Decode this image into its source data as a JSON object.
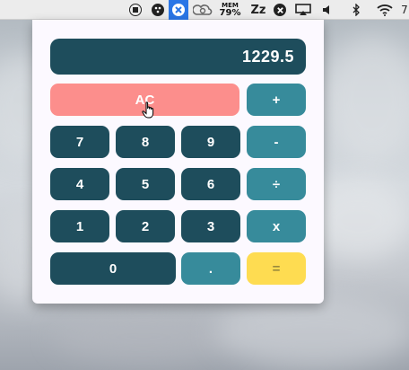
{
  "menubar": {
    "icons": [
      {
        "name": "stop-icon"
      },
      {
        "name": "dots-icon"
      },
      {
        "name": "calculator-app-icon",
        "highlighted": true
      },
      {
        "name": "creative-cloud-icon"
      },
      {
        "name": "bluetooth-icon"
      },
      {
        "name": "wifi-icon"
      }
    ],
    "mem_label": "MEM",
    "mem_value": "79%",
    "sleep_label": "Zᴢ",
    "partial_label": "7"
  },
  "calculator": {
    "display_value": "1229.5",
    "keys": {
      "clear": "AC",
      "plus": "+",
      "minus": "-",
      "divide": "÷",
      "multiply": "x",
      "equals": "=",
      "decimal": ".",
      "seven": "7",
      "eight": "8",
      "nine": "9",
      "four": "4",
      "five": "5",
      "six": "6",
      "one": "1",
      "two": "2",
      "three": "3",
      "zero": "0"
    }
  },
  "colors": {
    "display_bg": "#1e4d5c",
    "digit_key": "#1e4d5c",
    "operator_key": "#378b9b",
    "clear_key": "#fc8e8c",
    "equals_key": "#fedc51",
    "popover_bg": "#fcf9ff"
  }
}
